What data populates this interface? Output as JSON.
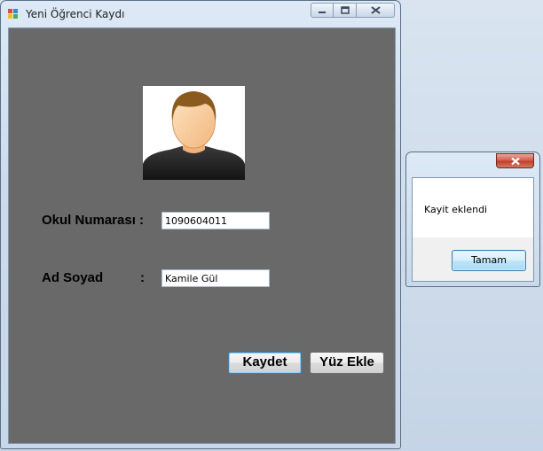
{
  "main_window": {
    "title": "Yeni Öğrenci Kaydı",
    "icons": {
      "app": "app-icon",
      "minimize": "minimize-icon",
      "maximize": "maximize-icon",
      "close": "close-icon"
    },
    "form": {
      "photo_icon": "user-avatar-icon",
      "student_no_label": "Okul Numarası :",
      "student_no_value": "1090604011",
      "name_label": "Ad Soyad",
      "name_colon": ":",
      "name_value": "Kamile Gül",
      "save_button": "Kaydet",
      "add_face_button": "Yüz Ekle"
    },
    "colors": {
      "client_bg": "#696969",
      "focus_border": "#3c7fb1"
    }
  },
  "message_box": {
    "close_icon": "close-icon",
    "text": "Kayit eklendi",
    "ok_button": "Tamam",
    "colors": {
      "close_button": "#c7422e"
    }
  }
}
